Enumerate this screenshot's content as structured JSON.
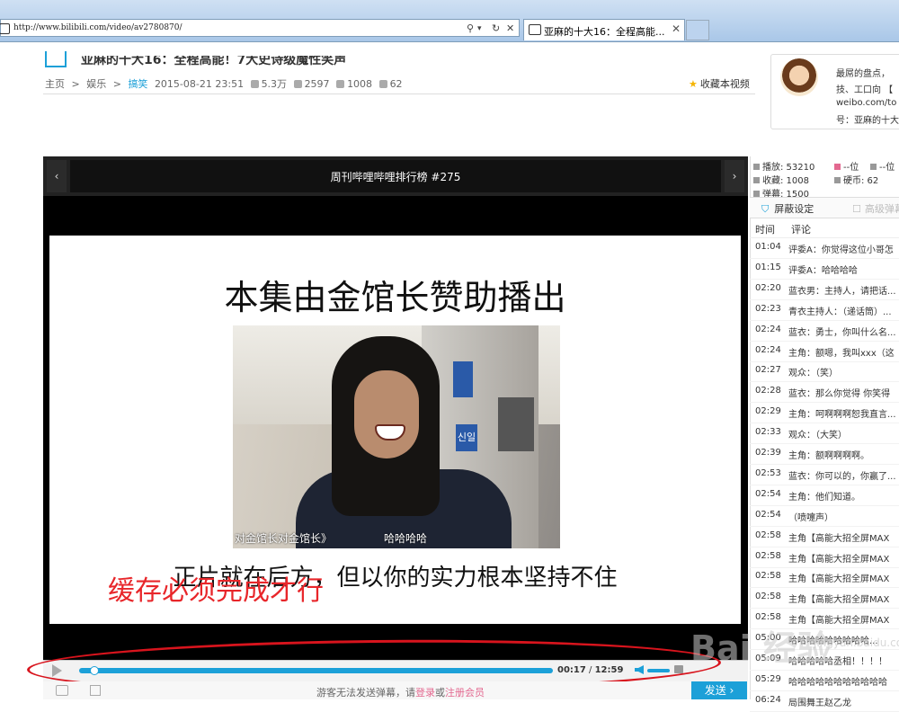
{
  "browser": {
    "url": "http://www.bilibili.com/video/av2780870/",
    "tab_title": "亚麻的十大16：全程高能...",
    "tab_close": "✕",
    "search_icon": "⚲",
    "refresh_icon": "↻",
    "stop_icon": "✕",
    "dropdown_icon": "▾"
  },
  "header": {
    "title": "亚麻的十大16：全程高能！7大史诗级魔性笑声",
    "breadcrumb": [
      "主页",
      "娱乐",
      "搞笑"
    ],
    "separator": ">",
    "date": "2015-08-21 23:51",
    "plays": "5.3万",
    "danmaku": "2597",
    "favorites": "1008",
    "coins": "62",
    "favorite_label": "收藏本视频"
  },
  "uploader": {
    "lines": [
      "最屌的盘点，",
      "技、工口向 【",
      "weibo.com/to",
      "号：亚麻的十大"
    ]
  },
  "player": {
    "title": "周刊哔哩哔哩排行榜 #275",
    "nav_left": "‹",
    "nav_right": "›",
    "slide_heading": "本集由金馆长赞助播出",
    "subtitle_left": "对金馆长对金馆长》",
    "subtitle_right": "哈哈哈哈",
    "sign_text": "신일",
    "slide_bottom": "正片就在后方，但以你的实力根本坚持不住",
    "annotation": "缓存必须完成才行",
    "current_time": "00:17",
    "time_sep": "/",
    "duration": "12:59",
    "progress_pct": 2
  },
  "stats": {
    "play": "播放: 53210",
    "fav": "收藏: 1008",
    "danmu": "弹幕: 1500",
    "rank1": "--位",
    "rank2": "--位",
    "coin": "硬币: 62"
  },
  "panel": {
    "tab_shield": "屏蔽设定",
    "tab_advanced": "高级弹幕",
    "col_time": "时间",
    "col_comment": "评论"
  },
  "comments": [
    {
      "time": "01:04",
      "text": "评委A：你觉得这位小哥怎"
    },
    {
      "time": "01:15",
      "text": "评委A：哈哈哈哈"
    },
    {
      "time": "02:20",
      "text": "蓝衣男：主持人，请把话..."
    },
    {
      "time": "02:23",
      "text": "青衣主持人：（递话筒）..."
    },
    {
      "time": "02:24",
      "text": "蓝衣：勇士，你叫什么名..."
    },
    {
      "time": "02:24",
      "text": "主角：额嗯，我叫xxx（这"
    },
    {
      "time": "02:27",
      "text": "观众：（笑）"
    },
    {
      "time": "02:28",
      "text": "蓝衣：那么你觉得 你笑得"
    },
    {
      "time": "02:29",
      "text": "主角：呵啊啊啊恕我直言..."
    },
    {
      "time": "02:33",
      "text": "观众：（大笑）"
    },
    {
      "time": "02:39",
      "text": "主角：额啊啊啊啊。"
    },
    {
      "time": "02:53",
      "text": "蓝衣：你可以的，你赢了..."
    },
    {
      "time": "02:54",
      "text": "主角：他们知道。"
    },
    {
      "time": "02:54",
      "text": "（喷嚏声）"
    },
    {
      "time": "02:58",
      "text": "主角【高能大招全屏MAX"
    },
    {
      "time": "02:58",
      "text": "主角【高能大招全屏MAX"
    },
    {
      "time": "02:58",
      "text": "主角【高能大招全屏MAX"
    },
    {
      "time": "02:58",
      "text": "主角【高能大招全屏MAX"
    },
    {
      "time": "02:58",
      "text": "主角【高能大招全屏MAX"
    },
    {
      "time": "05:00",
      "text": "哈哈哈哈哈哈哈哈哈..."
    },
    {
      "time": "05:09",
      "text": "哈哈哈哈哈丞相！！！！"
    },
    {
      "time": "05:29",
      "text": "哈哈哈哈哈哈哈哈哈哈哈"
    },
    {
      "time": "06:24",
      "text": "局围舞王赵乙龙"
    }
  ],
  "bottom": {
    "guest_text_1": "游客无法发送弹幕，请",
    "login": "登录",
    "or": "或",
    "register": "注册会员",
    "send": "发送 ›"
  },
  "watermark": {
    "main": "Bai 经验",
    "sub": "jingyan.baidu.com"
  },
  "colors": {
    "accent": "#1ca0d8",
    "annotation": "#e8262a",
    "link_pink": "#e36990"
  }
}
